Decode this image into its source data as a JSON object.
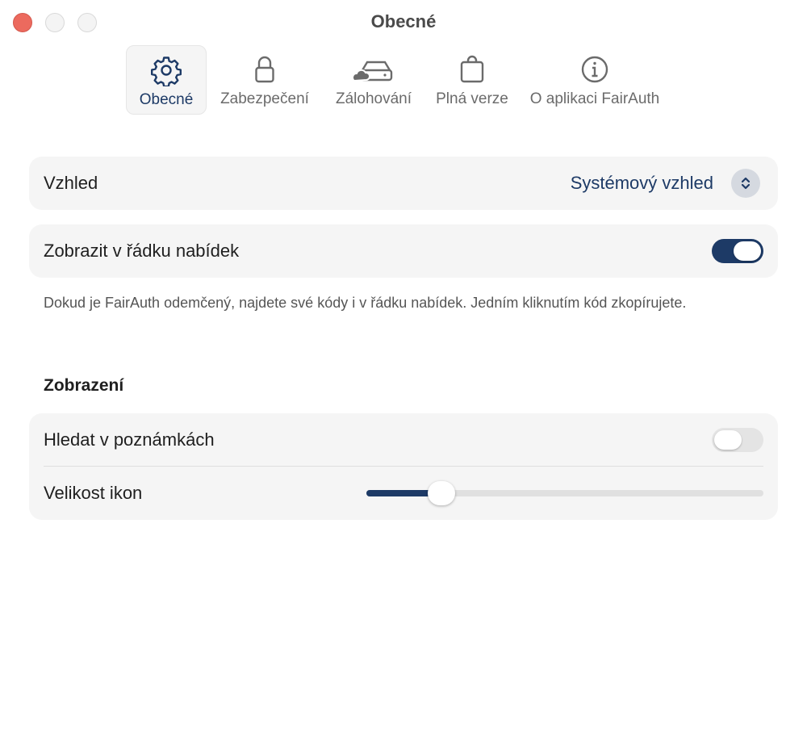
{
  "window": {
    "title": "Obecné"
  },
  "toolbar": {
    "tabs": [
      {
        "label": "Obecné",
        "icon": "gear-icon",
        "active": true
      },
      {
        "label": "Zabezpečení",
        "icon": "lock-icon",
        "active": false
      },
      {
        "label": "Zálohování",
        "icon": "cloud-drive-icon",
        "active": false
      },
      {
        "label": "Plná verze",
        "icon": "shopping-bag-icon",
        "active": false
      },
      {
        "label": "O aplikaci FairAuth",
        "icon": "info-circle-icon",
        "active": false
      }
    ]
  },
  "appearance": {
    "label": "Vzhled",
    "value": "Systémový vzhled"
  },
  "menubar": {
    "label": "Zobrazit v řádku nabídek",
    "enabled": true,
    "description": "Dokud je FairAuth odemčený, najdete své kódy i v řádku nabídek. Jedním kliknutím kód zkopírujete."
  },
  "display": {
    "heading": "Zobrazení",
    "search_notes": {
      "label": "Hledat v poznámkách",
      "enabled": false
    },
    "icon_size": {
      "label": "Velikost ikon",
      "fraction": 0.19
    }
  },
  "colors": {
    "accent": "#1d3a66",
    "close": "#ec6a5e",
    "card": "#f5f5f5"
  }
}
